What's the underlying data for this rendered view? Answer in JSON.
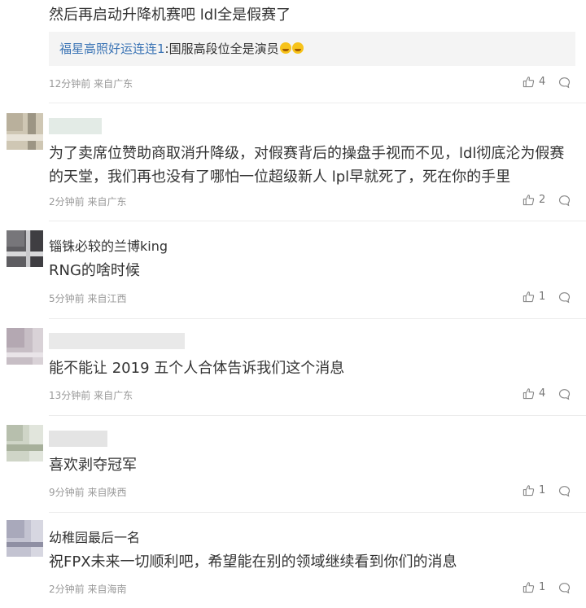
{
  "comments": [
    {
      "username": "",
      "text": "然后再启动升降机赛吧 ldl全是假赛了",
      "quote": {
        "name": "福星高照好运连连1",
        "sep": ":",
        "text": "国服高段位全是演员"
      },
      "time": "12分钟前 来自广东",
      "likes": "4"
    },
    {
      "username": "",
      "text": "为了卖席位赞助商取消升降级，对假赛背后的操盘手视而不见，ldl彻底沦为假赛的天堂，我们再也没有了哪怕一位超级新人 lpl早就死了，死在你的手里",
      "time": "2分钟前 来自广东",
      "likes": "2"
    },
    {
      "username": "锱铢必较的兰博king",
      "text": "RNG的啥时候",
      "time": "5分钟前 来自江西",
      "likes": "1"
    },
    {
      "username": "",
      "text": "能不能让 2019 五个人合体告诉我们这个消息",
      "time": "13分钟前 来自广东",
      "likes": "4"
    },
    {
      "username": "",
      "text": "喜欢剥夺冠军",
      "time": "9分钟前 来自陕西",
      "likes": "1"
    },
    {
      "username": "幼稚园最后一名",
      "text": "祝FPX未来一切顺利吧，希望能在别的领域继续看到你们的消息",
      "time": "2分钟前 来自海南",
      "likes": "1"
    }
  ],
  "icons": {
    "like": "thumbs-up-icon",
    "reply": "comment-bubble-icon"
  },
  "colors": {
    "link": "#3b74b5",
    "meta": "#999999",
    "quote_bg": "#f4f4f4",
    "divider": "#ececec"
  }
}
